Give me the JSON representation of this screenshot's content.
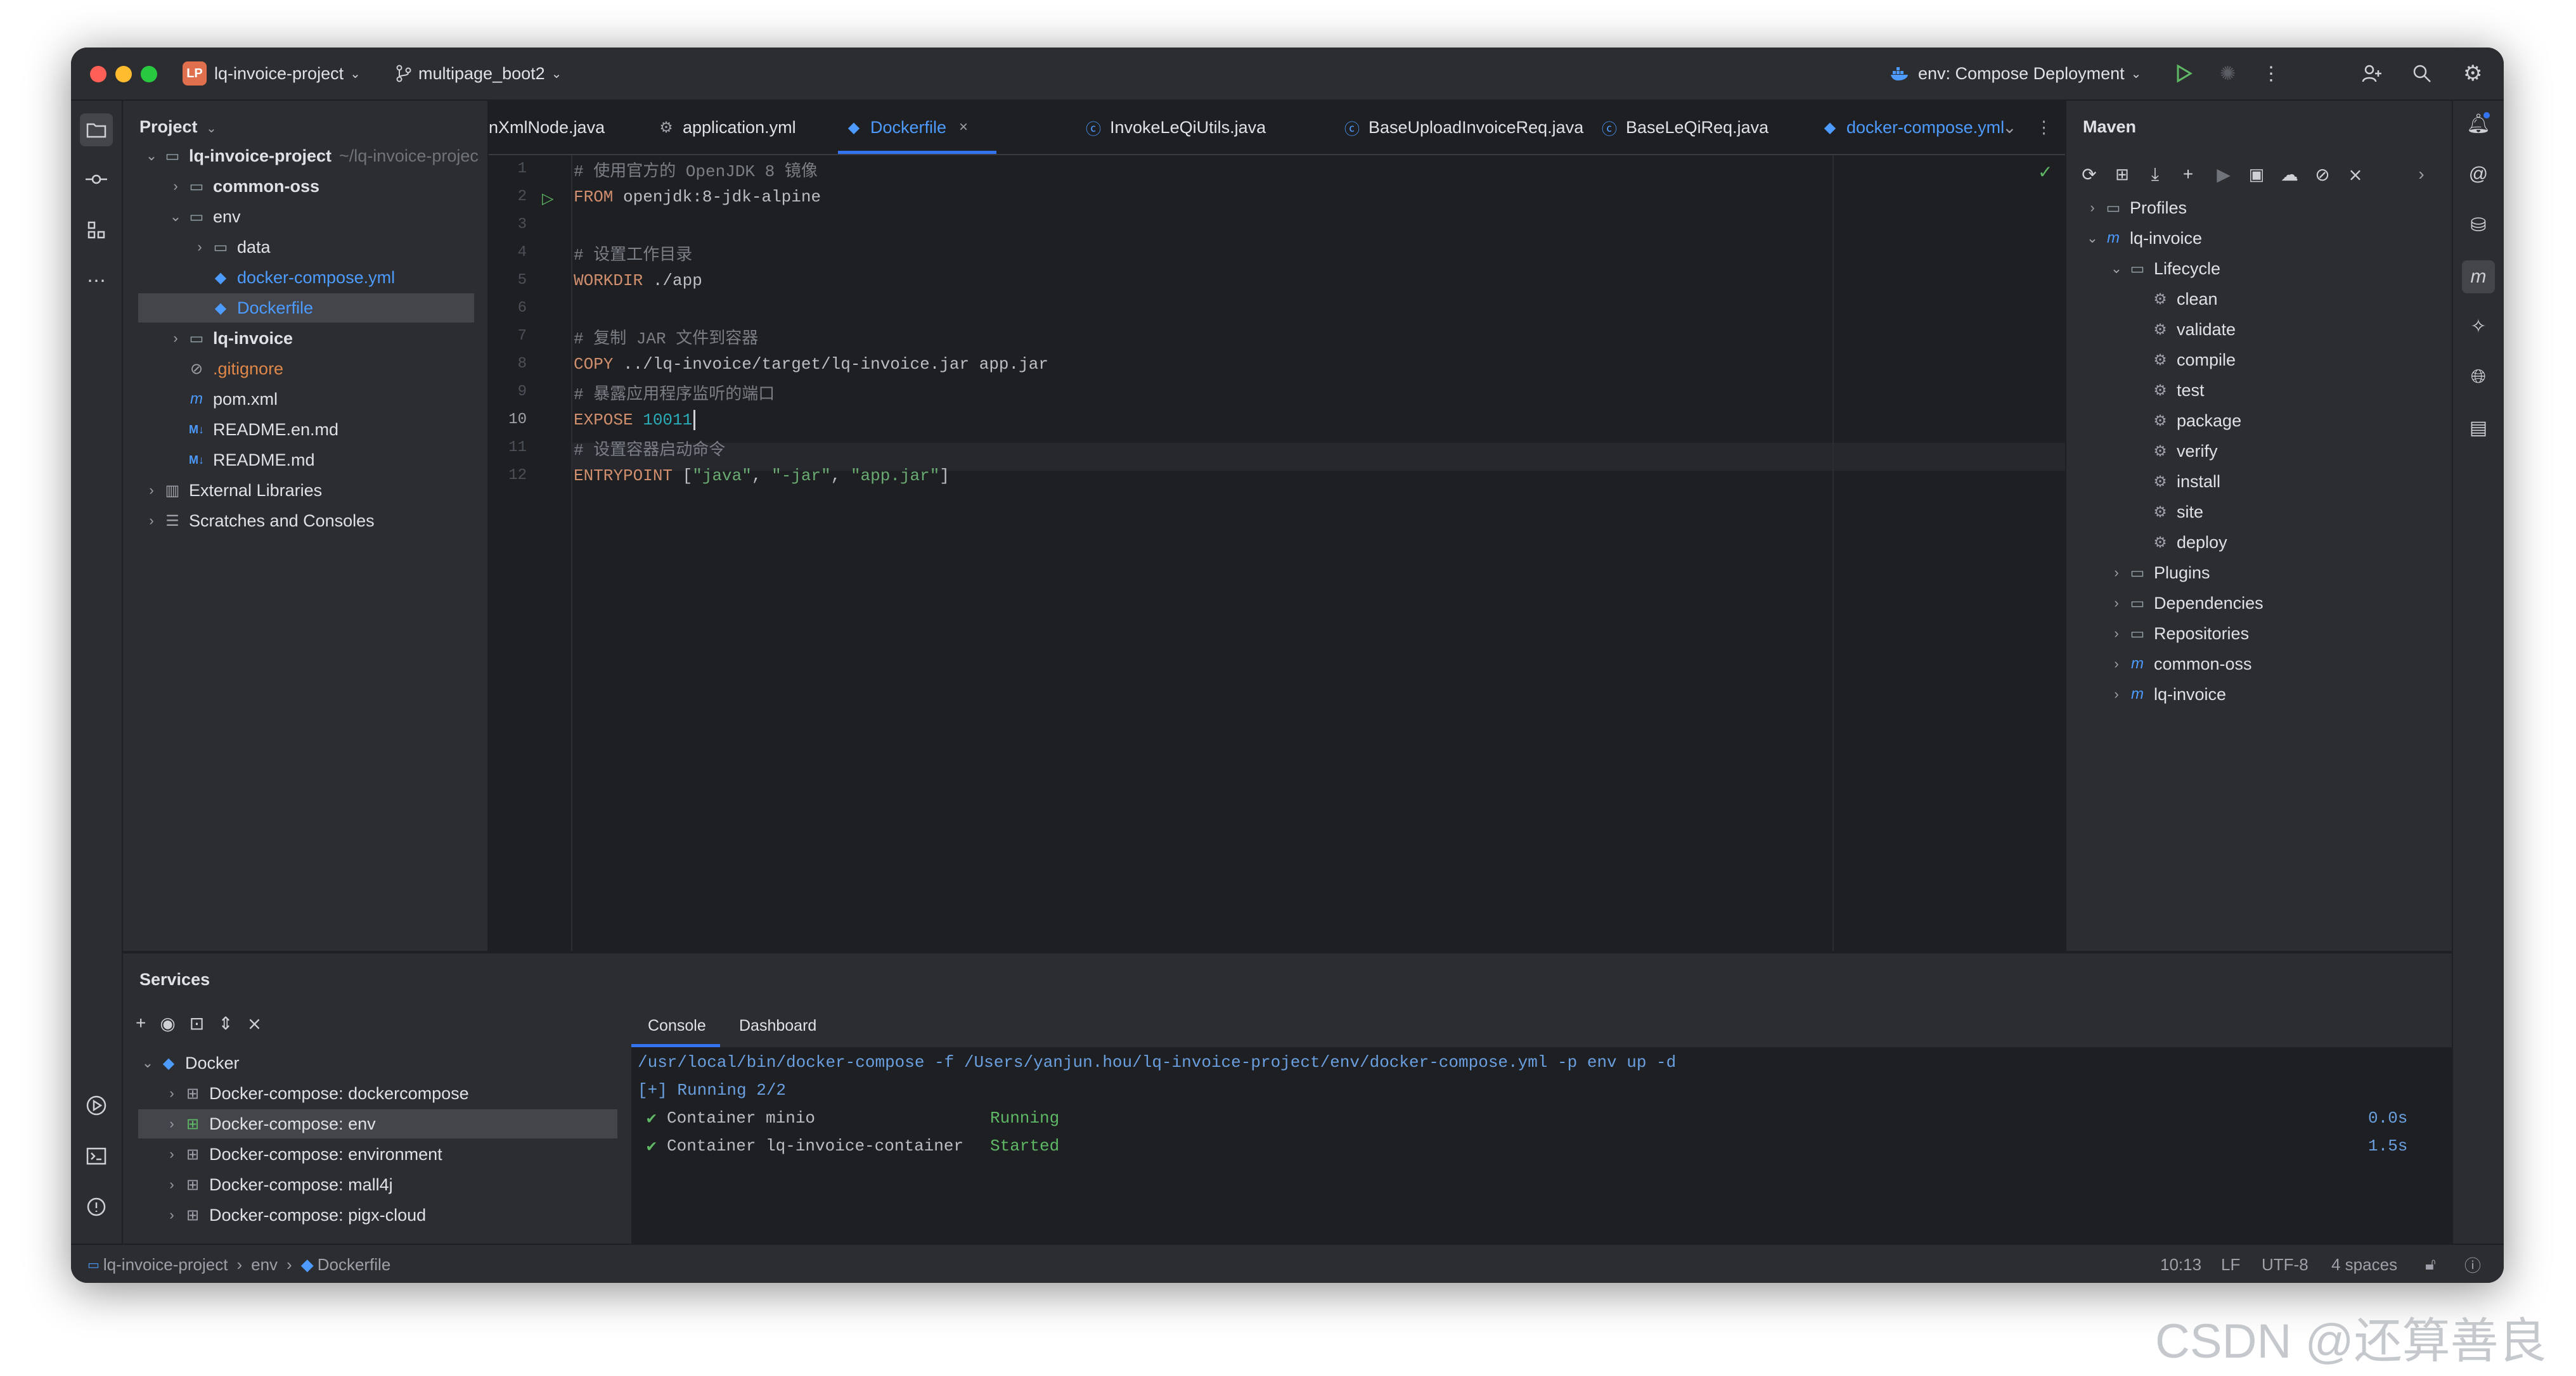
{
  "titlebar": {
    "project_badge": "LP",
    "project": "lq-invoice-project",
    "branch": "multipage_boot2",
    "run_config": "env: Compose Deployment"
  },
  "project_panel": {
    "title": "Project",
    "root_name": "lq-invoice-project",
    "root_path": "~/lq-invoice-projec",
    "items": [
      {
        "label": "common-oss"
      },
      {
        "label": "env"
      },
      {
        "label": "data"
      },
      {
        "label": "docker-compose.yml"
      },
      {
        "label": "Dockerfile"
      },
      {
        "label": "lq-invoice"
      },
      {
        "label": ".gitignore"
      },
      {
        "label": "pom.xml"
      },
      {
        "label": "README.en.md"
      },
      {
        "label": "README.md"
      },
      {
        "label": "External Libraries"
      },
      {
        "label": "Scratches and Consoles"
      }
    ]
  },
  "tabs": [
    {
      "label": "nXmlNode.java"
    },
    {
      "label": "application.yml"
    },
    {
      "label": "Dockerfile"
    },
    {
      "label": "InvokeLeQiUtils.java"
    },
    {
      "label": "BaseUploadInvoiceReq.java"
    },
    {
      "label": "BaseLeQiReq.java"
    },
    {
      "label": "docker-compose.yml"
    }
  ],
  "editor": {
    "line_numbers": [
      "1",
      "2",
      "3",
      "4",
      "5",
      "6",
      "7",
      "8",
      "9",
      "10",
      "11",
      "12"
    ],
    "lines": {
      "l1": "# 使用官方的 OpenJDK 8 镜像",
      "l2_kw": "FROM",
      "l2_rest": " openjdk:8-jdk-alpine",
      "l4": "# 设置工作目录",
      "l5_kw": "WORKDIR",
      "l5_rest": " ./app",
      "l7": "# 复制 JAR 文件到容器",
      "l8_kw": "COPY",
      "l8_rest": " ../lq-invoice/target/lq-invoice.jar app.jar",
      "l9": "# 暴露应用程序监听的端口",
      "l10_kw": "EXPOSE",
      "l10_num": " 10011",
      "l11": "# 设置容器启动命令",
      "l12_kw": "ENTRYPOINT",
      "l12_a": " [",
      "l12_s1": "\"java\"",
      "l12_c1": ", ",
      "l12_s2": "\"-jar\"",
      "l12_c2": ", ",
      "l12_s3": "\"app.jar\"",
      "l12_b": "]"
    }
  },
  "maven": {
    "title": "Maven",
    "items": [
      {
        "label": "Profiles"
      },
      {
        "label": "lq-invoice"
      },
      {
        "label": "Lifecycle"
      },
      {
        "label": "clean"
      },
      {
        "label": "validate"
      },
      {
        "label": "compile"
      },
      {
        "label": "test"
      },
      {
        "label": "package"
      },
      {
        "label": "verify"
      },
      {
        "label": "install"
      },
      {
        "label": "site"
      },
      {
        "label": "deploy"
      },
      {
        "label": "Plugins"
      },
      {
        "label": "Dependencies"
      },
      {
        "label": "Repositories"
      },
      {
        "label": "common-oss"
      },
      {
        "label": "lq-invoice"
      }
    ]
  },
  "services": {
    "title": "Services",
    "items": [
      {
        "label": "Docker"
      },
      {
        "label": "Docker-compose: dockercompose"
      },
      {
        "label": "Docker-compose: env"
      },
      {
        "label": "Docker-compose: environment"
      },
      {
        "label": "Docker-compose: mall4j"
      },
      {
        "label": "Docker-compose: pigx-cloud"
      }
    ],
    "tabs": [
      {
        "label": "Console"
      },
      {
        "label": "Dashboard"
      }
    ],
    "console": {
      "cmd": "/usr/local/bin/docker-compose -f /Users/yanjun.hou/lq-invoice-project/env/docker-compose.yml -p env up -d",
      "running": "[+] Running 2/2",
      "rows": [
        {
          "check": "✔",
          "name": "Container minio",
          "state": "Running",
          "time": "0.0s"
        },
        {
          "check": "✔",
          "name": "Container lq-invoice-container",
          "state": "Started",
          "time": "1.5s"
        }
      ]
    }
  },
  "statusbar": {
    "crumbs": [
      {
        "label": "lq-invoice-project"
      },
      {
        "label": "env"
      },
      {
        "label": "Dockerfile"
      }
    ],
    "position": "10:13",
    "line_sep": "LF",
    "encoding": "UTF-8",
    "indent": "4 spaces"
  },
  "watermark": "CSDN @还算善良"
}
